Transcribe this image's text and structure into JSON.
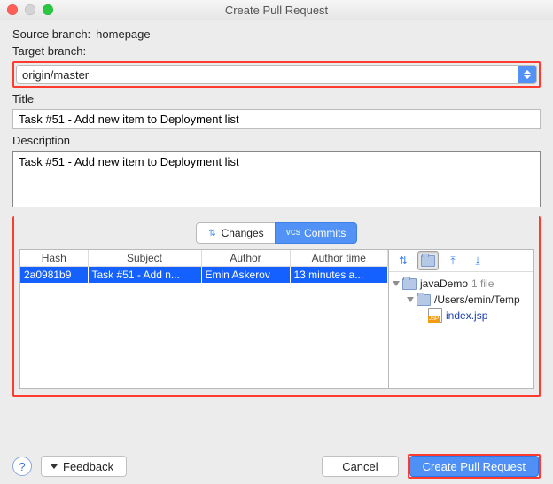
{
  "window": {
    "title": "Create Pull Request"
  },
  "labels": {
    "source_branch": "Source branch:",
    "target_branch": "Target branch:",
    "title": "Title",
    "description": "Description"
  },
  "source_branch_value": "homepage",
  "target_branch_value": "origin/master",
  "title_value": "Task #51 - Add new item to Deployment list",
  "description_value": "Task #51 - Add new item to Deployment list",
  "tabs": {
    "changes": "Changes",
    "commits": "Commits"
  },
  "commits_table": {
    "headers": {
      "hash": "Hash",
      "subject": "Subject",
      "author": "Author",
      "time": "Author time"
    },
    "rows": [
      {
        "hash": "2a0981b9",
        "subject": "Task #51 - Add n...",
        "author": "Emin Askerov",
        "time": "13 minutes a..."
      }
    ]
  },
  "file_tree": {
    "root": {
      "name": "javaDemo",
      "count": "1 file"
    },
    "path": "/Users/emin/Temp",
    "file": "index.jsp"
  },
  "footer": {
    "feedback": "Feedback",
    "cancel": "Cancel",
    "submit": "Create Pull Request"
  }
}
